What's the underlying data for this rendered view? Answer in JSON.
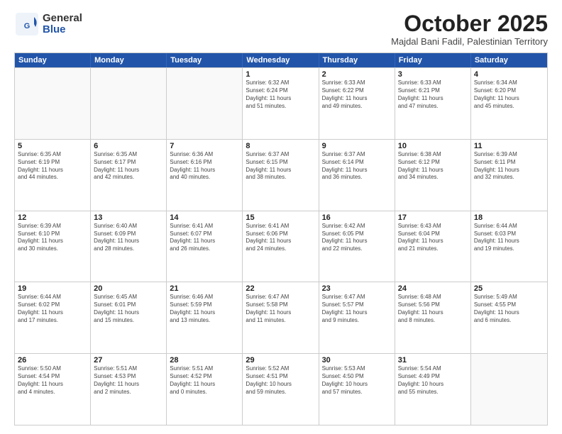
{
  "logo": {
    "general": "General",
    "blue": "Blue"
  },
  "header": {
    "month": "October 2025",
    "location": "Majdal Bani Fadil, Palestinian Territory"
  },
  "days": [
    "Sunday",
    "Monday",
    "Tuesday",
    "Wednesday",
    "Thursday",
    "Friday",
    "Saturday"
  ],
  "rows": [
    [
      {
        "day": "",
        "info": ""
      },
      {
        "day": "",
        "info": ""
      },
      {
        "day": "",
        "info": ""
      },
      {
        "day": "1",
        "info": "Sunrise: 6:32 AM\nSunset: 6:24 PM\nDaylight: 11 hours\nand 51 minutes."
      },
      {
        "day": "2",
        "info": "Sunrise: 6:33 AM\nSunset: 6:22 PM\nDaylight: 11 hours\nand 49 minutes."
      },
      {
        "day": "3",
        "info": "Sunrise: 6:33 AM\nSunset: 6:21 PM\nDaylight: 11 hours\nand 47 minutes."
      },
      {
        "day": "4",
        "info": "Sunrise: 6:34 AM\nSunset: 6:20 PM\nDaylight: 11 hours\nand 45 minutes."
      }
    ],
    [
      {
        "day": "5",
        "info": "Sunrise: 6:35 AM\nSunset: 6:19 PM\nDaylight: 11 hours\nand 44 minutes."
      },
      {
        "day": "6",
        "info": "Sunrise: 6:35 AM\nSunset: 6:17 PM\nDaylight: 11 hours\nand 42 minutes."
      },
      {
        "day": "7",
        "info": "Sunrise: 6:36 AM\nSunset: 6:16 PM\nDaylight: 11 hours\nand 40 minutes."
      },
      {
        "day": "8",
        "info": "Sunrise: 6:37 AM\nSunset: 6:15 PM\nDaylight: 11 hours\nand 38 minutes."
      },
      {
        "day": "9",
        "info": "Sunrise: 6:37 AM\nSunset: 6:14 PM\nDaylight: 11 hours\nand 36 minutes."
      },
      {
        "day": "10",
        "info": "Sunrise: 6:38 AM\nSunset: 6:12 PM\nDaylight: 11 hours\nand 34 minutes."
      },
      {
        "day": "11",
        "info": "Sunrise: 6:39 AM\nSunset: 6:11 PM\nDaylight: 11 hours\nand 32 minutes."
      }
    ],
    [
      {
        "day": "12",
        "info": "Sunrise: 6:39 AM\nSunset: 6:10 PM\nDaylight: 11 hours\nand 30 minutes."
      },
      {
        "day": "13",
        "info": "Sunrise: 6:40 AM\nSunset: 6:09 PM\nDaylight: 11 hours\nand 28 minutes."
      },
      {
        "day": "14",
        "info": "Sunrise: 6:41 AM\nSunset: 6:07 PM\nDaylight: 11 hours\nand 26 minutes."
      },
      {
        "day": "15",
        "info": "Sunrise: 6:41 AM\nSunset: 6:06 PM\nDaylight: 11 hours\nand 24 minutes."
      },
      {
        "day": "16",
        "info": "Sunrise: 6:42 AM\nSunset: 6:05 PM\nDaylight: 11 hours\nand 22 minutes."
      },
      {
        "day": "17",
        "info": "Sunrise: 6:43 AM\nSunset: 6:04 PM\nDaylight: 11 hours\nand 21 minutes."
      },
      {
        "day": "18",
        "info": "Sunrise: 6:44 AM\nSunset: 6:03 PM\nDaylight: 11 hours\nand 19 minutes."
      }
    ],
    [
      {
        "day": "19",
        "info": "Sunrise: 6:44 AM\nSunset: 6:02 PM\nDaylight: 11 hours\nand 17 minutes."
      },
      {
        "day": "20",
        "info": "Sunrise: 6:45 AM\nSunset: 6:01 PM\nDaylight: 11 hours\nand 15 minutes."
      },
      {
        "day": "21",
        "info": "Sunrise: 6:46 AM\nSunset: 5:59 PM\nDaylight: 11 hours\nand 13 minutes."
      },
      {
        "day": "22",
        "info": "Sunrise: 6:47 AM\nSunset: 5:58 PM\nDaylight: 11 hours\nand 11 minutes."
      },
      {
        "day": "23",
        "info": "Sunrise: 6:47 AM\nSunset: 5:57 PM\nDaylight: 11 hours\nand 9 minutes."
      },
      {
        "day": "24",
        "info": "Sunrise: 6:48 AM\nSunset: 5:56 PM\nDaylight: 11 hours\nand 8 minutes."
      },
      {
        "day": "25",
        "info": "Sunrise: 5:49 AM\nSunset: 4:55 PM\nDaylight: 11 hours\nand 6 minutes."
      }
    ],
    [
      {
        "day": "26",
        "info": "Sunrise: 5:50 AM\nSunset: 4:54 PM\nDaylight: 11 hours\nand 4 minutes."
      },
      {
        "day": "27",
        "info": "Sunrise: 5:51 AM\nSunset: 4:53 PM\nDaylight: 11 hours\nand 2 minutes."
      },
      {
        "day": "28",
        "info": "Sunrise: 5:51 AM\nSunset: 4:52 PM\nDaylight: 11 hours\nand 0 minutes."
      },
      {
        "day": "29",
        "info": "Sunrise: 5:52 AM\nSunset: 4:51 PM\nDaylight: 10 hours\nand 59 minutes."
      },
      {
        "day": "30",
        "info": "Sunrise: 5:53 AM\nSunset: 4:50 PM\nDaylight: 10 hours\nand 57 minutes."
      },
      {
        "day": "31",
        "info": "Sunrise: 5:54 AM\nSunset: 4:49 PM\nDaylight: 10 hours\nand 55 minutes."
      },
      {
        "day": "",
        "info": ""
      }
    ]
  ]
}
